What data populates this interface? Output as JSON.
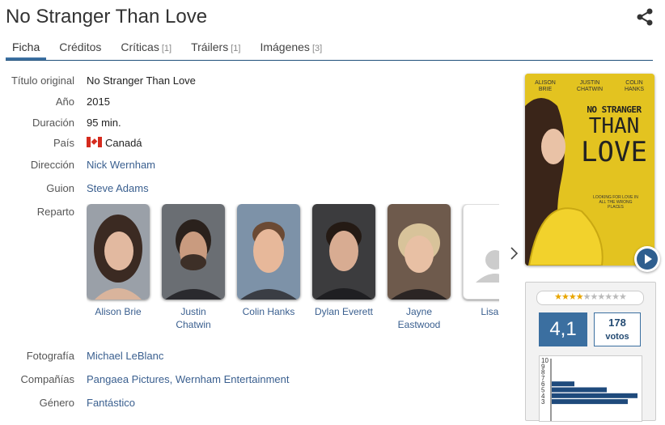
{
  "title": "No Stranger Than Love",
  "tabs": [
    {
      "label": "Ficha",
      "count": ""
    },
    {
      "label": "Créditos",
      "count": ""
    },
    {
      "label": "Críticas",
      "count": "[1]"
    },
    {
      "label": "Tráilers",
      "count": "[1]"
    },
    {
      "label": "Imágenes",
      "count": "[3]"
    }
  ],
  "info": {
    "original_title": {
      "label": "Título original",
      "value": "No Stranger Than Love"
    },
    "year": {
      "label": "Año",
      "value": "2015"
    },
    "duration": {
      "label": "Duración",
      "value": "95 min."
    },
    "country": {
      "label": "País",
      "value": "Canadá"
    },
    "director": {
      "label": "Dirección",
      "value": "Nick Wernham"
    },
    "writer": {
      "label": "Guion",
      "value": "Steve Adams"
    },
    "cast_label": "Reparto",
    "photography": {
      "label": "Fotografía",
      "value": "Michael LeBlanc"
    },
    "companies": {
      "label": "Compañías",
      "value": "Pangaea Pictures, Wernham Entertainment"
    },
    "genre": {
      "label": "Género",
      "value": "Fantástico"
    }
  },
  "cast": [
    "Alison Brie",
    "Justin Chatwin",
    "Colin Hanks",
    "Dylan Everett",
    "Jayne Eastwood",
    "Lisa B"
  ],
  "poster": {
    "names": [
      "ALISON BRIE",
      "JUSTIN CHATWIN",
      "COLIN HANKS"
    ],
    "title_lines": [
      "NO STRANGER",
      "THAN",
      "LOVE"
    ],
    "tagline": "LOOKING FOR LOVE IN ALL THE WRONG PLACES"
  },
  "rating": {
    "average": "4,1",
    "votes_count": "178",
    "votes_label": "votos",
    "stars_value": 4.1,
    "stars_max": 10,
    "hist_labels": [
      "10",
      "9",
      "8",
      "7",
      "6",
      "5",
      "4",
      "3"
    ]
  },
  "colors": {
    "accent": "#3b6fa0",
    "link": "#3a5f8f"
  }
}
